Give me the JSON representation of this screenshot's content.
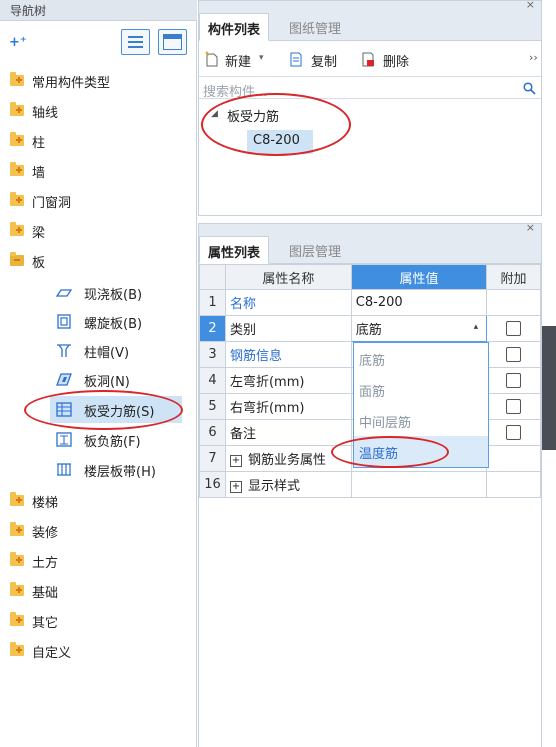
{
  "nav": {
    "title": "导航树",
    "add_icon": "add-subitem-icon",
    "items": [
      {
        "label": "常用构件类型"
      },
      {
        "label": "轴线"
      },
      {
        "label": "柱"
      },
      {
        "label": "墙"
      },
      {
        "label": "门窗洞"
      },
      {
        "label": "梁"
      },
      {
        "label": "板"
      },
      {
        "label": "楼梯"
      },
      {
        "label": "装修"
      },
      {
        "label": "土方"
      },
      {
        "label": "基础"
      },
      {
        "label": "其它"
      },
      {
        "label": "自定义"
      }
    ],
    "board_children": [
      {
        "label": "现浇板(B)",
        "icon": "cast-slab-icon"
      },
      {
        "label": "螺旋板(B)",
        "icon": "spiral-slab-icon"
      },
      {
        "label": "柱帽(V)",
        "icon": "column-cap-icon"
      },
      {
        "label": "板洞(N)",
        "icon": "slab-hole-icon"
      },
      {
        "label": "板受力筋(S)",
        "icon": "slab-rebar-icon"
      },
      {
        "label": "板负筋(F)",
        "icon": "slab-negative-rebar-icon"
      },
      {
        "label": "楼层板带(H)",
        "icon": "floor-strip-icon"
      }
    ]
  },
  "component_panel": {
    "tabs": [
      "构件列表",
      "图纸管理"
    ],
    "toolbar": {
      "new": "新建",
      "copy": "复制",
      "delete": "删除",
      "more": "››"
    },
    "search_placeholder": "搜索构件...",
    "tree_root": "板受力筋",
    "tree_child": "C8-200",
    "close": "×"
  },
  "property_panel": {
    "tabs": [
      "属性列表",
      "图层管理"
    ],
    "close": "×",
    "columns": [
      "属性名称",
      "属性值",
      "附加"
    ],
    "rows": [
      {
        "num": "1",
        "name": "名称",
        "value": "C8-200",
        "has_check": false
      },
      {
        "num": "2",
        "name": "类别",
        "value": "底筋",
        "has_check": true
      },
      {
        "num": "3",
        "name": "钢筋信息",
        "value": "",
        "has_check": true
      },
      {
        "num": "4",
        "name": "左弯折(mm)",
        "value": "",
        "has_check": true
      },
      {
        "num": "5",
        "name": "右弯折(mm)",
        "value": "",
        "has_check": true
      },
      {
        "num": "6",
        "name": "备注",
        "value": "",
        "has_check": true
      },
      {
        "num": "7",
        "name": "钢筋业务属性",
        "value": "",
        "has_check": false
      },
      {
        "num": "16",
        "name": "显示样式",
        "value": "",
        "has_check": false
      }
    ],
    "expander": "+",
    "dropdown_arrow": "▴",
    "dropdown_options": [
      "底筋",
      "面筋",
      "中间层筋",
      "温度筋"
    ]
  },
  "colors": {
    "accent": "#3f8ee0",
    "highlight_oval": "#d8262a",
    "folder": "#f2c14e"
  }
}
